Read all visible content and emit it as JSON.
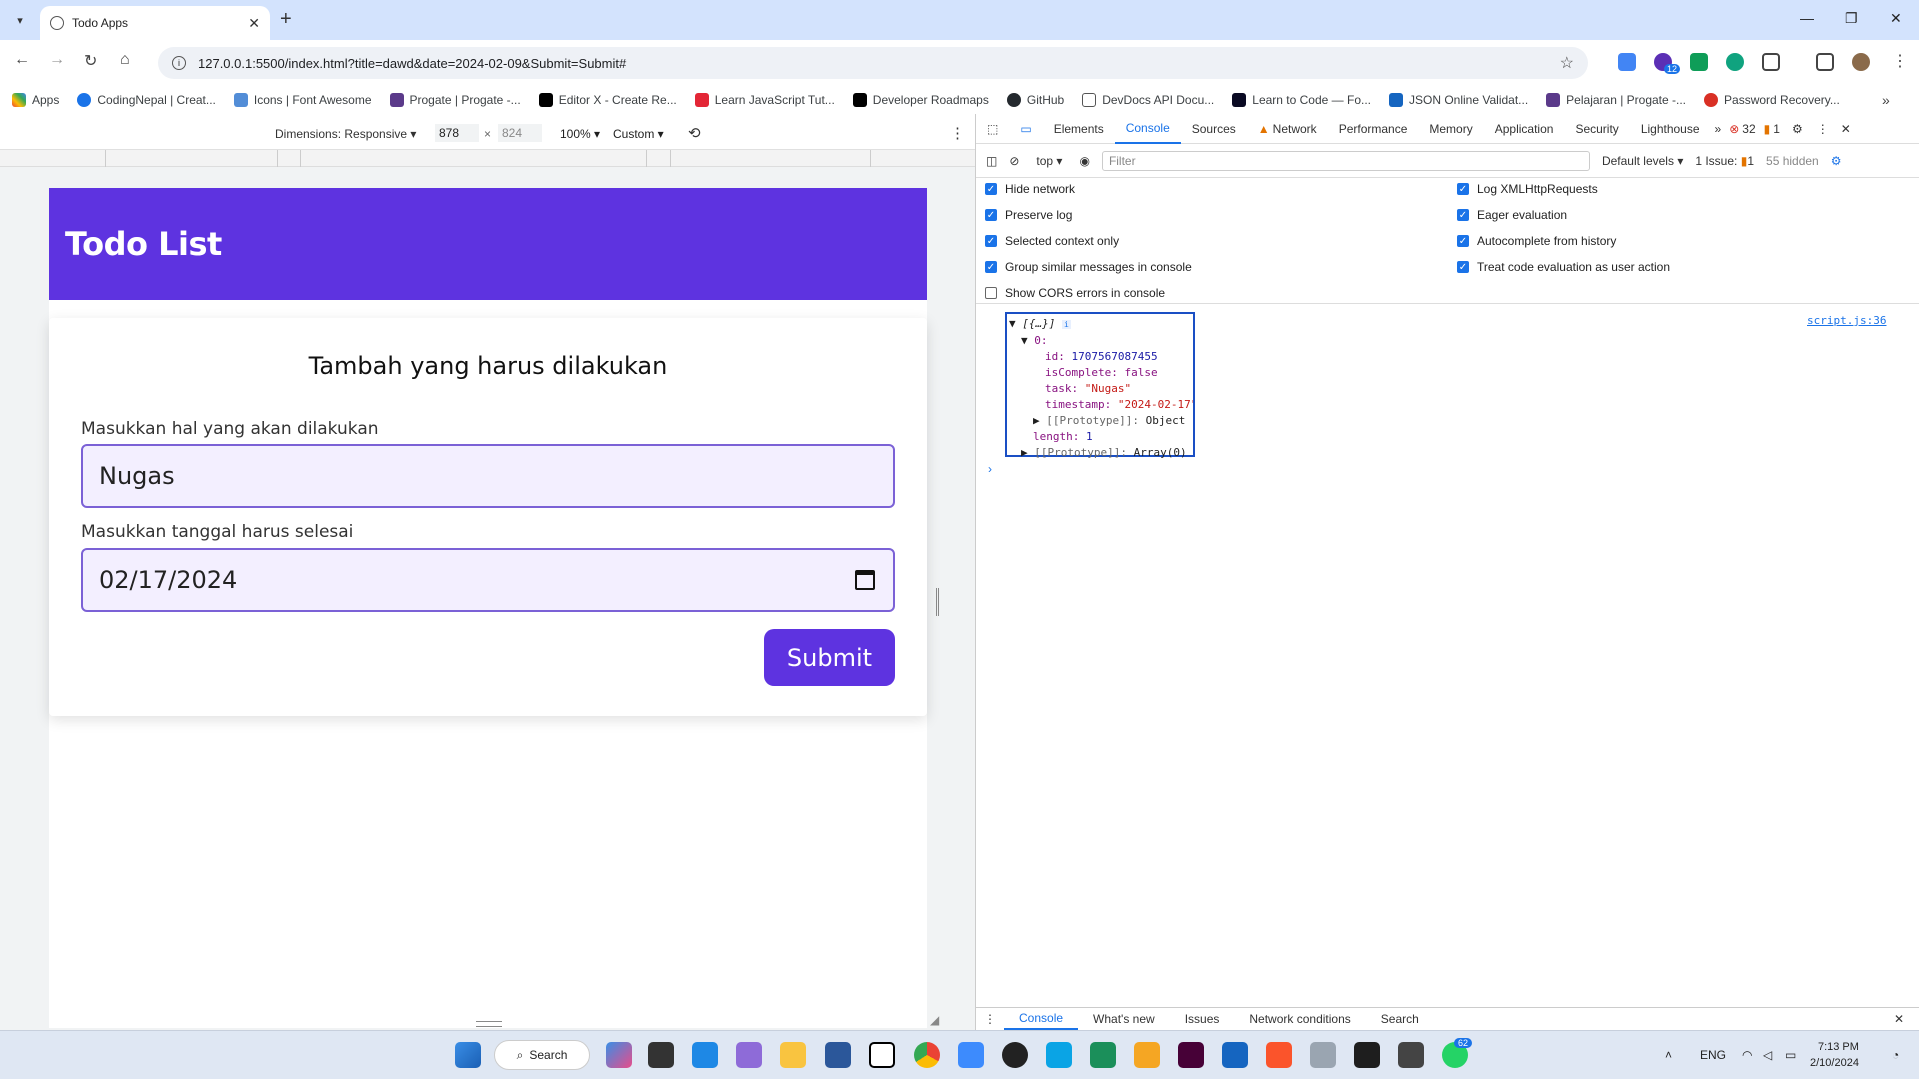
{
  "browser": {
    "tab_title": "Todo Apps",
    "url": "127.0.0.1:5500/index.html?title=dawd&date=2024-02-09&Submit=Submit#",
    "bookmarks": [
      "Apps",
      "CodingNepal | Creat...",
      "Icons | Font Awesome",
      "Progate | Progate -...",
      "Editor X - Create Re...",
      "Learn JavaScript Tut...",
      "Developer Roadmaps",
      "GitHub",
      "DevDocs API Docu...",
      "Learn to Code — Fo...",
      "JSON Online Validat...",
      "Pelajaran | Progate -...",
      "Password Recovery..."
    ],
    "extension_badge": "12"
  },
  "device_toolbar": {
    "dimensions_label": "Dimensions: Responsive",
    "width": "878",
    "times": "×",
    "height": "824",
    "zoom": "100%",
    "throttle": "Custom"
  },
  "app": {
    "header_title": "Todo List",
    "form_title": "Tambah yang harus dilakukan",
    "task_label": "Masukkan hal yang akan dilakukan",
    "task_value": "Nugas",
    "date_label": "Masukkan tanggal harus selesai",
    "date_value": "02/17/2024",
    "submit_label": "Submit",
    "header_color": "#5e33e0"
  },
  "devtools": {
    "tabs": [
      "Elements",
      "Console",
      "Sources",
      "Network",
      "Performance",
      "Memory",
      "Application",
      "Security",
      "Lighthouse"
    ],
    "active_tab": "Console",
    "error_count": "32",
    "warning_count": "1",
    "context": "top",
    "filter_placeholder": "Filter",
    "levels": "Default levels",
    "issues": "1 Issue:",
    "issues_count": "1",
    "hidden": "55 hidden",
    "settings_left": [
      {
        "label": "Hide network",
        "checked": true
      },
      {
        "label": "Preserve log",
        "checked": true
      },
      {
        "label": "Selected context only",
        "checked": true
      },
      {
        "label": "Group similar messages in console",
        "checked": true
      },
      {
        "label": "Show CORS errors in console",
        "checked": false
      }
    ],
    "settings_right": [
      {
        "label": "Log XMLHttpRequests",
        "checked": true
      },
      {
        "label": "Eager evaluation",
        "checked": true
      },
      {
        "label": "Autocomplete from history",
        "checked": true
      },
      {
        "label": "Treat code evaluation as user action",
        "checked": true
      }
    ],
    "log": {
      "summary": "[{…}]",
      "index": "0:",
      "id_key": "id:",
      "id_value": "1707567087455",
      "complete_key": "isComplete:",
      "complete_value": "false",
      "task_key": "task:",
      "task_value": "\"Nugas\"",
      "ts_key": "timestamp:",
      "ts_value": "\"2024-02-17\"",
      "proto_obj_key": "[[Prototype]]:",
      "proto_obj_value": "Object",
      "length_key": "length:",
      "length_value": "1",
      "proto_arr_key": "[[Prototype]]:",
      "proto_arr_value": "Array(0)",
      "source": "script.js:36"
    },
    "drawer_tabs": [
      "Console",
      "What's new",
      "Issues",
      "Network conditions",
      "Search"
    ]
  },
  "taskbar": {
    "search_label": "Search",
    "whatsapp_badge": "62",
    "lang": "ENG",
    "time": "7:13 PM",
    "date": "2/10/2024"
  }
}
